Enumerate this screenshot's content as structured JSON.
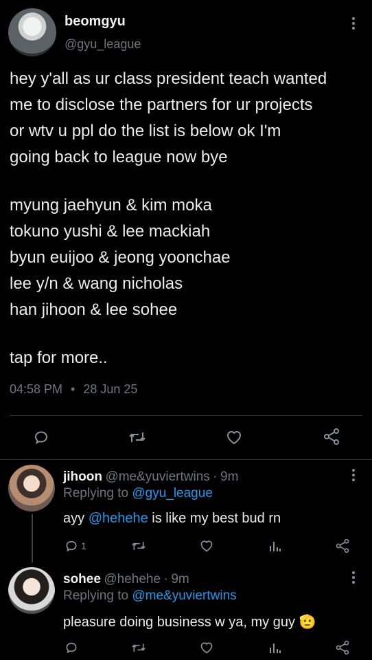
{
  "main_tweet": {
    "display_name": "beomgyu",
    "handle": "@gyu_league",
    "body": [
      "hey y'all as ur class president teach wanted",
      "me to disclose the partners for ur projects",
      "or wtv u ppl do the list is below ok I'm",
      "going back to league now bye"
    ],
    "partners": [
      "myung jaehyun & kim moka",
      "tokuno yushi & lee mackiah",
      "byun euijoo & jeong yoonchae",
      "lee y/n & wang nicholas",
      "han jihoon & lee sohee"
    ],
    "more_text": "tap for more..",
    "time": "04:58 PM",
    "separator": "•",
    "date": "28 Jun 25"
  },
  "replies": [
    {
      "display_name": "jihoon",
      "handle": "@me&yuviertwins",
      "separator": "·",
      "age": "9m",
      "replying_to_label": "Replying to",
      "replying_to_handle": "@gyu_league",
      "text_prefix": "ayy ",
      "text_mention": "@hehehe",
      "text_suffix": " is like my best bud rn",
      "reply_count": "1"
    },
    {
      "display_name": "sohee",
      "handle": "@hehehe",
      "separator": "·",
      "age": "9m",
      "replying_to_label": "Replying to",
      "replying_to_handle": "@me&yuviertwins",
      "text": "pleasure doing business w ya, my guy",
      "emoji": "🫡"
    }
  ],
  "icons": {
    "reply": "reply-icon",
    "retweet": "retweet-icon",
    "like": "heart-icon",
    "share": "share-icon",
    "analytics": "analytics-icon",
    "more": "more-icon"
  },
  "colors": {
    "background": "#000000",
    "text": "#ececec",
    "secondary_text": "#71767b",
    "link": "#1d9bf0",
    "divider": "#2f3336"
  }
}
